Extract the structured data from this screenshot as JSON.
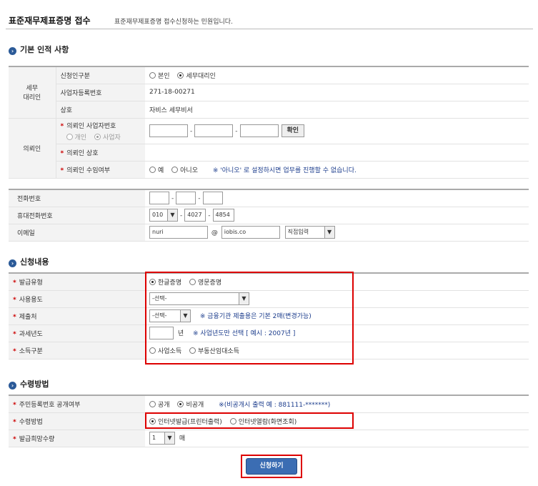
{
  "header": {
    "title": "표준재무제표증명 접수",
    "subtitle": "표준재무제표증명 접수신청하는 민원입니다."
  },
  "sections": {
    "basic": "기본 인적 사항",
    "apply": "신청내용",
    "receive": "수령방법"
  },
  "tax_agent": {
    "group_label": "세무\n대리인",
    "applicant_type_label": "신청인구분",
    "applicant_type_options": [
      "본인",
      "세무대리인"
    ],
    "biz_no_label": "사업자등록번호",
    "biz_no_value": "271-18-00271",
    "name_label": "상호",
    "name_value": "자비스 세무비서"
  },
  "client": {
    "group_label": "의뢰인",
    "biz_no_label": "의뢰인 사업자번호",
    "type_options": [
      "개인",
      "사업자"
    ],
    "confirm_button": "확인",
    "name_label": "의뢰인 상호",
    "consent_label": "의뢰인 수임여부",
    "consent_options": [
      "예",
      "아니오"
    ],
    "consent_note": "※ '아니오' 로 설정하시면 업무를 진행할 수 없습니다."
  },
  "contact": {
    "phone_label": "전화번호",
    "mobile_label": "휴대전화번호",
    "mobile_prefix": "010",
    "mobile_mid": "4027",
    "mobile_last": "4854",
    "email_label": "이메일",
    "email_id": "nuri",
    "email_at": "@",
    "email_domain": "iobis.co",
    "email_select": "직접입력"
  },
  "apply": {
    "issue_type_label": "발급유형",
    "issue_type_options": [
      "한글증명",
      "영문증명"
    ],
    "usage_label": "사용용도",
    "usage_value": "-선택-",
    "submit_to_label": "제출처",
    "submit_to_value": "-선택-",
    "submit_to_note": "※ 금융기관 제출용은 기본 2매(변경가능)",
    "tax_year_label": "과세년도",
    "tax_year_unit": "년",
    "tax_year_note": "※ 사업년도만 선택 [ 예시 : 2007년 ]",
    "income_type_label": "소득구분",
    "income_type_options": [
      "사업소득",
      "부동산임대소득"
    ]
  },
  "receive": {
    "rrn_label": "주민등록번호 공개여부",
    "rrn_options": [
      "공개",
      "비공개"
    ],
    "rrn_note": "※(비공개시 출력 예 : 881111-*******)",
    "method_label": "수령방법",
    "method_options": [
      "인터넷발급(프린터출력)",
      "인터넷열람(화면조회)"
    ],
    "count_label": "발급희망수량",
    "count_value": "1",
    "count_unit": "매"
  },
  "submit_button": "신청하기"
}
